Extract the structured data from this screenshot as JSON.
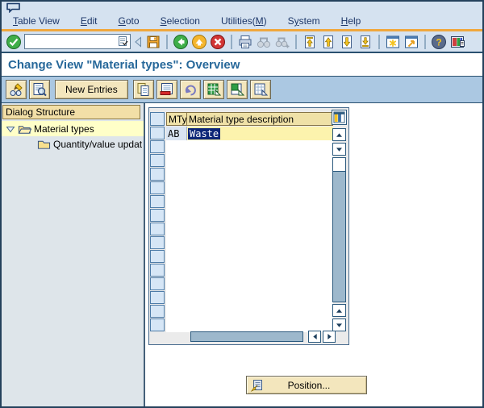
{
  "menu": {
    "items": [
      {
        "label": "Table View",
        "underline": 0
      },
      {
        "label": "Edit",
        "underline": 0
      },
      {
        "label": "Goto",
        "underline": 0
      },
      {
        "label": "Selection",
        "underline": 0
      },
      {
        "label": "Utilities(M)",
        "underline": 10
      },
      {
        "label": "System",
        "underline": 1
      },
      {
        "label": "Help",
        "underline": 0
      }
    ]
  },
  "std_toolbar": {
    "command_field": {
      "value": "",
      "placeholder": ""
    },
    "buttons": [
      {
        "name": "enter",
        "enabled": true
      },
      {
        "name": "collapse-command-field",
        "enabled": true
      },
      {
        "name": "save",
        "enabled": true
      },
      {
        "name": "back",
        "enabled": true
      },
      {
        "name": "exit",
        "enabled": true
      },
      {
        "name": "cancel",
        "enabled": true
      },
      {
        "name": "print",
        "enabled": true
      },
      {
        "name": "find",
        "enabled": false
      },
      {
        "name": "find-next",
        "enabled": false
      },
      {
        "name": "first-page",
        "enabled": true
      },
      {
        "name": "page-up",
        "enabled": true
      },
      {
        "name": "page-down",
        "enabled": true
      },
      {
        "name": "last-page",
        "enabled": true
      },
      {
        "name": "new-session",
        "enabled": true
      },
      {
        "name": "create-shortcut",
        "enabled": true
      },
      {
        "name": "help",
        "enabled": true
      },
      {
        "name": "customize-layout",
        "enabled": true
      }
    ]
  },
  "title": "Change View \"Material types\": Overview",
  "app_toolbar": {
    "new_entries_label": "New Entries",
    "buttons": [
      "toggle-display-change",
      "overview",
      "copy-as",
      "delete",
      "undo",
      "select-all",
      "select-block",
      "deselect-all"
    ]
  },
  "dialog_structure": {
    "header": "Dialog Structure",
    "items": [
      {
        "label": "Material types",
        "expanded": true,
        "selected": true
      },
      {
        "label": "Quantity/value updat",
        "expanded": false,
        "selected": false
      }
    ]
  },
  "table": {
    "columns": [
      {
        "label": "MTyp"
      },
      {
        "label": "Material type description"
      }
    ],
    "rows": [
      {
        "mtyp": "AB",
        "desc": "Waste",
        "desc_selected": true
      }
    ],
    "empty_rows": 14
  },
  "position_button": {
    "label": "Position..."
  },
  "colors": {
    "selection_navy": "#0c2577",
    "row_highlight_yellow": "#fcf3ad",
    "header_beige": "#efe1a7",
    "toolbar_blue": "#abc8e2",
    "panel_grey": "#dee5ea",
    "accent_orange": "#f0a73c",
    "title_blue": "#27689a",
    "scrollbar_track": "#9db8cc"
  }
}
